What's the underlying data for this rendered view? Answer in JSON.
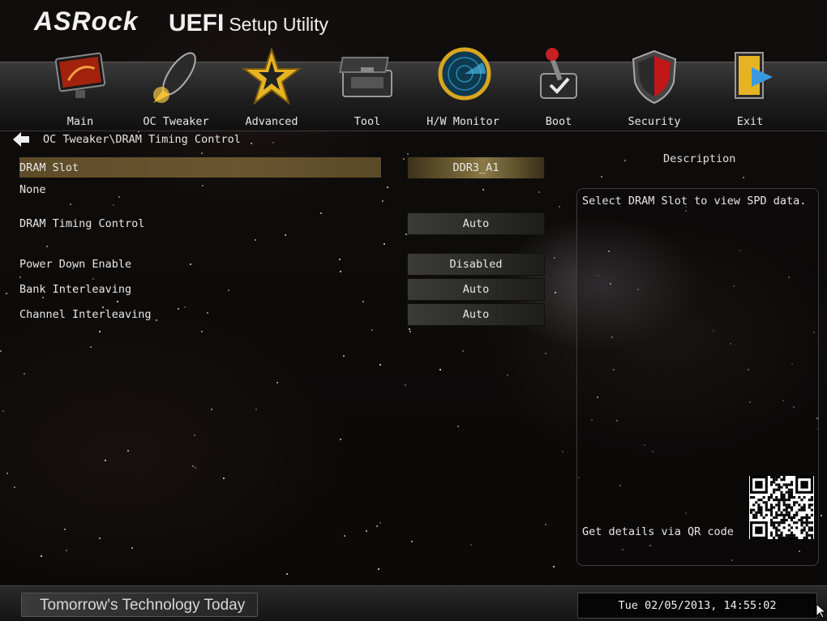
{
  "header": {
    "brand": "ASRock",
    "title_main": "UEFI",
    "title_sub": "Setup Utility"
  },
  "nav": {
    "items": [
      {
        "label": "Main",
        "icon": "monitor-icon"
      },
      {
        "label": "OC Tweaker",
        "icon": "rocket-icon"
      },
      {
        "label": "Advanced",
        "icon": "star-icon"
      },
      {
        "label": "Tool",
        "icon": "toolbox-icon"
      },
      {
        "label": "H/W Monitor",
        "icon": "radar-icon"
      },
      {
        "label": "Boot",
        "icon": "joystick-icon"
      },
      {
        "label": "Security",
        "icon": "shield-icon"
      },
      {
        "label": "Exit",
        "icon": "exit-door-icon"
      }
    ],
    "active": "OC Tweaker"
  },
  "breadcrumb": "OC Tweaker\\DRAM Timing Control",
  "settings": {
    "dram_slot": {
      "label": "DRAM Slot",
      "value": "DDR3_A1"
    },
    "slot_info": "None",
    "dram_timing": {
      "label": "DRAM Timing Control",
      "value": "Auto"
    },
    "power_down": {
      "label": "Power Down Enable",
      "value": "Disabled"
    },
    "bank_interleaving": {
      "label": "Bank Interleaving",
      "value": "Auto"
    },
    "channel_interleaving": {
      "label": "Channel Interleaving",
      "value": "Auto"
    }
  },
  "description": {
    "title": "Description",
    "text": "Select DRAM Slot to view SPD data.",
    "qr_text": "Get details via QR code"
  },
  "footer": {
    "tagline": "Tomorrow's Technology Today",
    "datetime": "Tue 02/05/2013, 14:55:02"
  },
  "colors": {
    "highlight": "#6b5530",
    "active_value": "#8a7a48",
    "accent_gold": "#e6b422"
  }
}
